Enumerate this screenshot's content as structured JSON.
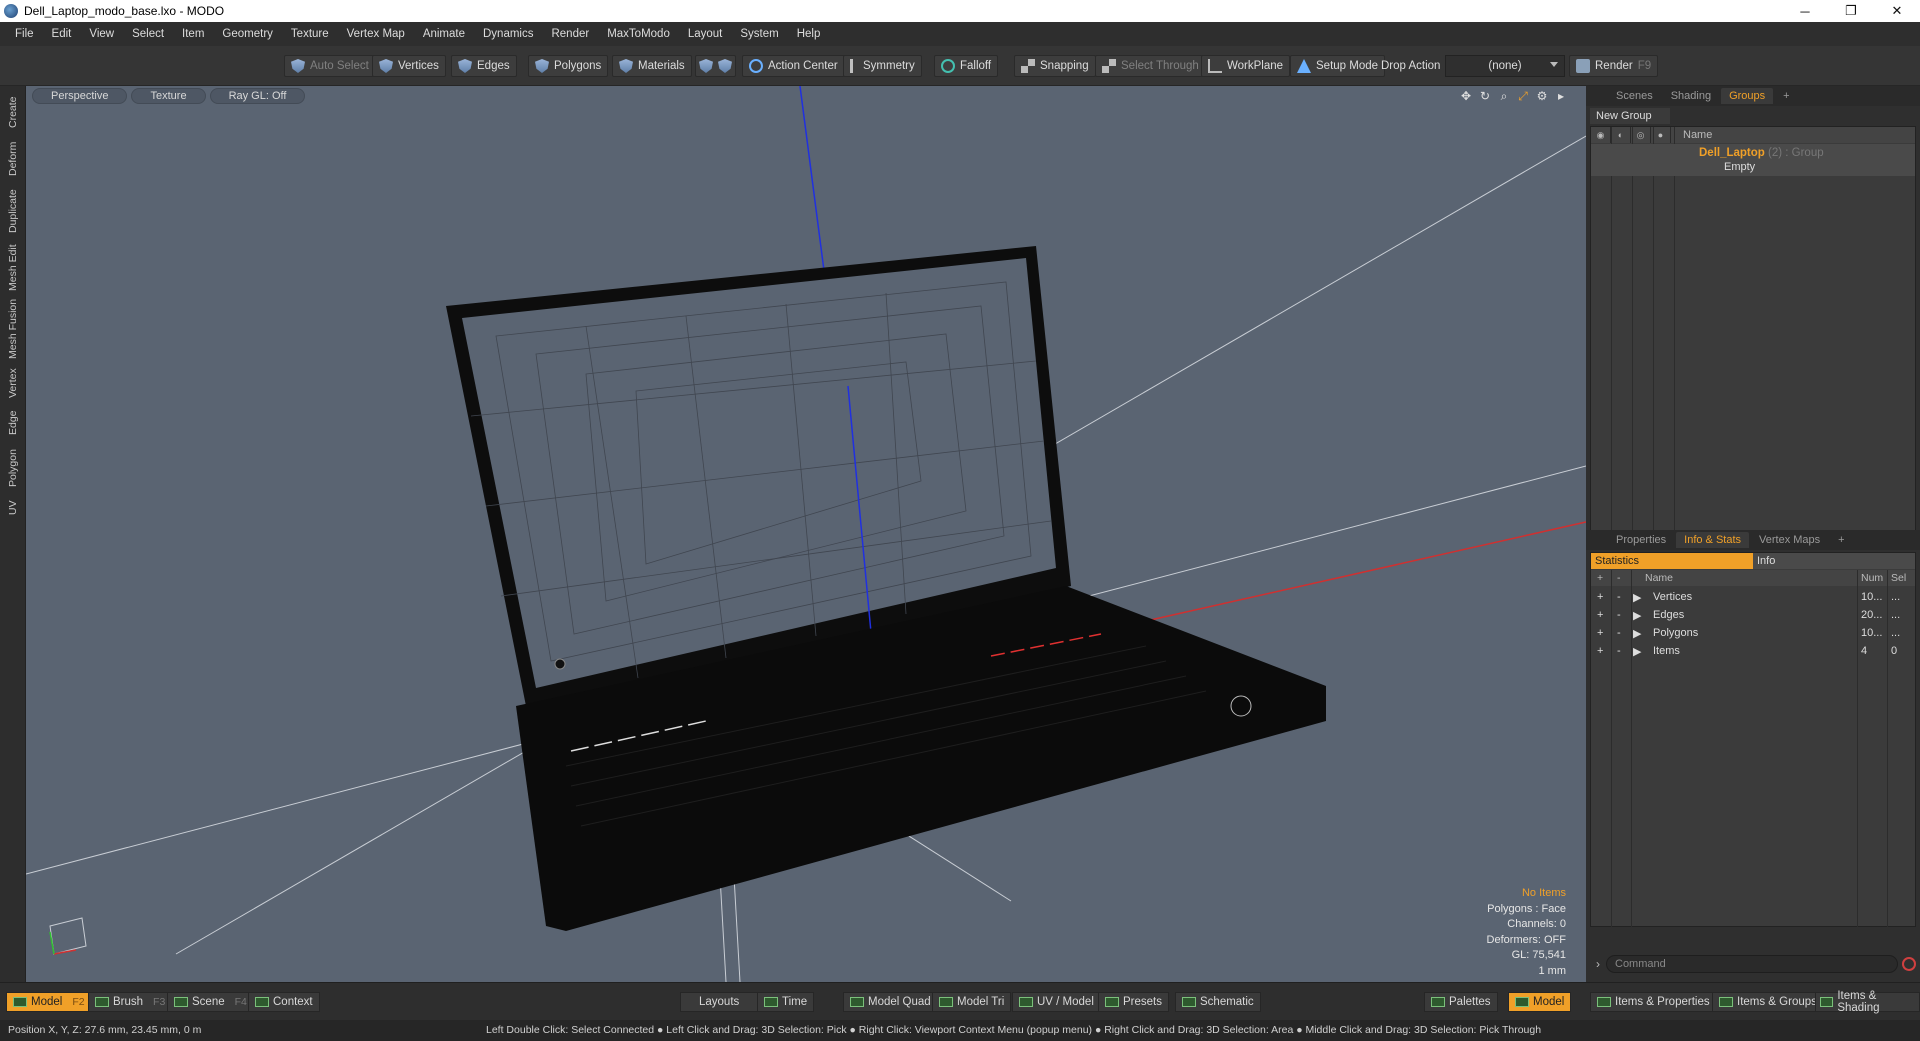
{
  "window": {
    "title": "Dell_Laptop_modo_base.lxo - MODO",
    "min_glyph": "─",
    "restore_glyph": "❐",
    "close_glyph": "✕"
  },
  "menu": [
    "File",
    "Edit",
    "View",
    "Select",
    "Item",
    "Geometry",
    "Texture",
    "Vertex Map",
    "Animate",
    "Dynamics",
    "Render",
    "MaxToModo",
    "Layout",
    "System",
    "Help"
  ],
  "toolbar": {
    "auto_select": "Auto Select",
    "vertices": "Vertices",
    "edges": "Edges",
    "polygons": "Polygons",
    "materials": "Materials",
    "action_center": "Action Center",
    "symmetry": "Symmetry",
    "falloff": "Falloff",
    "snapping": "Snapping",
    "select_through": "Select Through",
    "workplane": "WorkPlane",
    "setup_mode": "Setup Mode",
    "drop_action_label": "Drop Action",
    "drop_action_value": "(none)",
    "render": "Render",
    "render_key": "F9"
  },
  "left_tabs": [
    "Create",
    "Deform",
    "Duplicate",
    "Mesh Edit",
    "Mesh Fusion",
    "Vertex",
    "Edge",
    "Polygon",
    "UV"
  ],
  "viewport": {
    "view_mode": "Perspective",
    "shading": "Texture",
    "raygl": "Ray GL: Off",
    "info": {
      "no_items": "No Items",
      "polygons": "Polygons : Face",
      "channels": "Channels: 0",
      "deformers": "Deformers: OFF",
      "gl": "GL: 75,541",
      "unit": "1 mm"
    }
  },
  "groups_panel": {
    "tabs": [
      "Scenes",
      "Shading",
      "Groups"
    ],
    "active_tab": "Groups",
    "new_group": "New Group",
    "col_name": "Name",
    "item_name": "Dell_Laptop",
    "item_meta": "(2) : Group",
    "item_sub": "Empty"
  },
  "props_panel": {
    "tabs": [
      "Properties",
      "Info & Stats",
      "Vertex Maps"
    ],
    "active_tab": "Info & Stats",
    "subtab_statistics": "Statistics",
    "subtab_info": "Info",
    "col_name": "Name",
    "col_num": "Num",
    "col_sel": "Sel",
    "rows": [
      {
        "name": "Vertices",
        "num": "10...",
        "sel": "..."
      },
      {
        "name": "Edges",
        "num": "20...",
        "sel": "..."
      },
      {
        "name": "Polygons",
        "num": "10...",
        "sel": "..."
      },
      {
        "name": "Items",
        "num": "4",
        "sel": "0"
      }
    ]
  },
  "command": {
    "placeholder": "Command"
  },
  "bottom": {
    "model": "Model",
    "model_key": "F2",
    "brush": "Brush",
    "brush_key": "F3",
    "scene": "Scene",
    "scene_key": "F4",
    "context": "Context",
    "layouts": "Layouts",
    "time": "Time",
    "model_quad": "Model Quad",
    "model_tri": "Model Tri",
    "uv_model": "UV / Model",
    "presets": "Presets",
    "schematic": "Schematic",
    "palettes": "Palettes",
    "model_right": "Model",
    "items_props": "Items & Properties",
    "items_groups": "Items & Groups",
    "items_shading": "Items & Shading"
  },
  "status": {
    "position": "Position X, Y, Z:   27.6 mm, 23.45 mm, 0 m",
    "hints": "Left Double Click: Select Connected ● Left Click and Drag: 3D Selection: Pick ● Right Click: Viewport Context Menu (popup menu) ● Right Click and Drag: 3D Selection: Area ● Middle Click and Drag: 3D Selection: Pick Through"
  },
  "colors": {
    "accent": "#f0a028",
    "viewport_bg": "#5a6472",
    "axis_x": "#d03030",
    "axis_y": "#30c030",
    "axis_z": "#2030e0"
  }
}
